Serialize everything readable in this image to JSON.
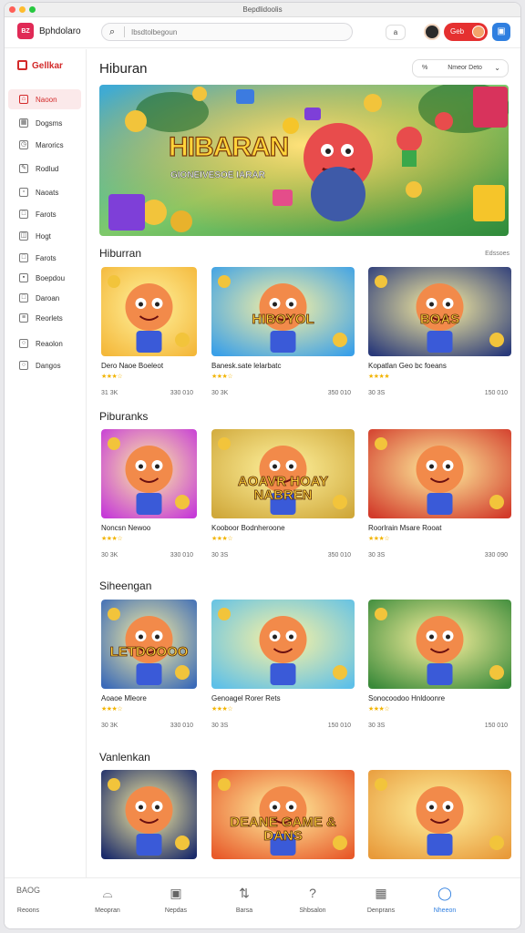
{
  "window": {
    "title": "Bepdlidoolis",
    "dot_colors": [
      "#ff5f57",
      "#febc2e",
      "#28c840"
    ]
  },
  "topbar": {
    "brand_logo_text": "BZ",
    "brand_name": "Bphdolaro",
    "search_placeholder": "Ibsdtolbegoun",
    "tool_label": "a",
    "red_button_label": "Geb",
    "blue_button_icon": "user-icon"
  },
  "sidebar": {
    "header": "Gellkar",
    "items": [
      {
        "label": "Naoon",
        "icon": "home-icon",
        "active": true
      },
      {
        "label": "Dogsms",
        "icon": "grid-icon"
      },
      {
        "label": "Marorics",
        "icon": "clock-icon"
      },
      {
        "label": "Rodlud",
        "icon": "pencil-icon"
      },
      {
        "label": "Naoats",
        "icon": "box-icon"
      },
      {
        "label": "Farots",
        "icon": "square-icon"
      },
      {
        "label": "Hogt",
        "icon": "bag-icon"
      },
      {
        "label": "Farots",
        "icon": "square-icon"
      },
      {
        "label": "Boepdou",
        "icon": "folder-icon"
      },
      {
        "label": "Daroan",
        "icon": "square-icon"
      },
      {
        "label": "Reorlets",
        "icon": "list-icon"
      },
      {
        "label": "Reaolon",
        "icon": "circle-icon"
      },
      {
        "label": "Dangos",
        "icon": "circle-icon"
      }
    ]
  },
  "main": {
    "title": "Hiburan",
    "sort": {
      "label": "Nmeor Deto",
      "icon_text": "%"
    },
    "hero": {
      "title": "HIBARAN",
      "subtitle": "GIONEIVESOE IARAR"
    },
    "sections": [
      {
        "title": "Hiburran",
        "see_all": "Edssoes",
        "cards": [
          {
            "title": "Dero Naoe Boeleot",
            "stars": "★★★☆",
            "meta_left": "31 3K",
            "meta_right": "330 010",
            "thumb_text": ""
          },
          {
            "title": "Banesk.sate lelarbatc",
            "stars": "★★★☆",
            "meta_left": "30 3K",
            "meta_right": "350 010",
            "thumb_text": "HIBOYOL"
          },
          {
            "title": "Kopatlan Geo bc foeans",
            "stars": "★★★★",
            "meta_left": "30 3S",
            "meta_right": "150 010",
            "thumb_text": "BOAS"
          }
        ]
      },
      {
        "title": "Piburanks",
        "see_all": "",
        "cards": [
          {
            "title": "Noncsn Newoo",
            "stars": "★★★☆",
            "meta_left": "30 3K",
            "meta_right": "330 010",
            "thumb_text": ""
          },
          {
            "title": "Kooboor Bodnheroone",
            "stars": "★★★☆",
            "meta_left": "30 3S",
            "meta_right": "350 010",
            "thumb_text": "AOAVR HOAY NABREN"
          },
          {
            "title": "Roorlrain Msare Rooat",
            "stars": "★★★☆",
            "meta_left": "30 3S",
            "meta_right": "330 090",
            "thumb_text": ""
          }
        ]
      },
      {
        "title": "Siheengan",
        "see_all": "",
        "cards": [
          {
            "title": "Aoaoe Mleore",
            "stars": "★★★☆",
            "meta_left": "30 3K",
            "meta_right": "330 010",
            "thumb_text": "LETDOOOO"
          },
          {
            "title": "Genoagel Rorer Rets",
            "stars": "★★★☆",
            "meta_left": "30 3S",
            "meta_right": "150 010",
            "thumb_text": ""
          },
          {
            "title": "Sonocoodoo Hnldoonre",
            "stars": "★★★☆",
            "meta_left": "30 3S",
            "meta_right": "150 010",
            "thumb_text": ""
          }
        ]
      },
      {
        "title": "Vanlenkan",
        "see_all": "",
        "cards": [
          {
            "title": "",
            "stars": "",
            "meta_left": "",
            "meta_right": "",
            "thumb_text": ""
          },
          {
            "title": "",
            "stars": "",
            "meta_left": "",
            "meta_right": "",
            "thumb_text": "DEANE GAME & DANS"
          },
          {
            "title": "",
            "stars": "",
            "meta_left": "",
            "meta_right": "",
            "thumb_text": ""
          }
        ]
      }
    ]
  },
  "bottom_nav": [
    {
      "label": "Reoons",
      "icon_text": "BAOG"
    },
    {
      "label": "Meopran",
      "icon": "bag-icon"
    },
    {
      "label": "Nepdas",
      "icon": "box-icon"
    },
    {
      "label": "Barsa",
      "icon": "swap-icon"
    },
    {
      "label": "Shbsalon",
      "icon": "help-icon"
    },
    {
      "label": "Denprans",
      "icon": "grid-icon"
    },
    {
      "label": "Nheeon",
      "icon": "chat-icon",
      "active": true
    }
  ],
  "colors": {
    "accent_red": "#d32a2a",
    "accent_blue": "#2f7fe0",
    "star": "#f2b400"
  }
}
